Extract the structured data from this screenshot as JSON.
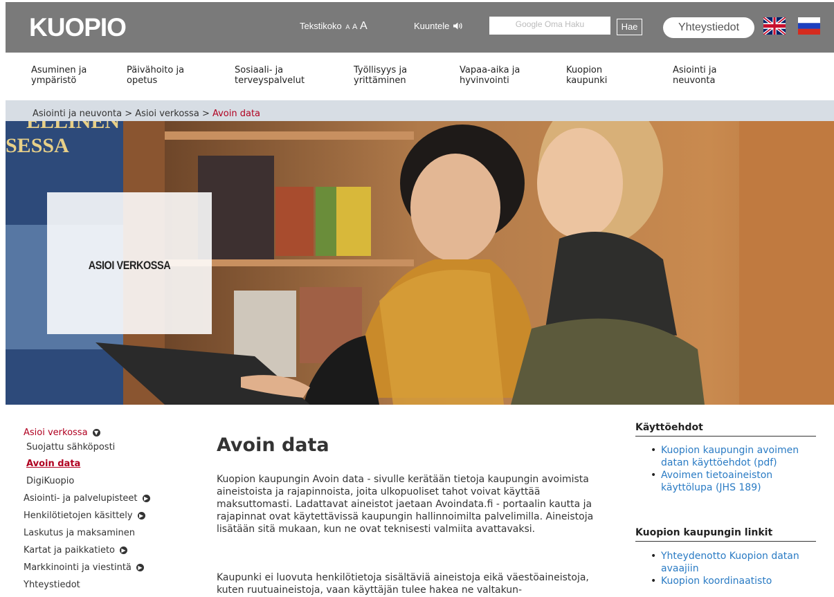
{
  "header": {
    "logo": "KUOPIO",
    "textsize_label": "Tekstikoko",
    "textsize_small": "A",
    "textsize_medium": "A",
    "textsize_large": "A",
    "listen_label": "Kuuntele",
    "search_placeholder": "Google Oma Haku",
    "search_button": "Hae",
    "contact_button": "Yhteystiedot",
    "bg_color": "#7a7a7a"
  },
  "main_nav": [
    {
      "line1": "Asuminen ja",
      "line2": "ympäristö"
    },
    {
      "line1": "Päivähoito ja",
      "line2": "opetus"
    },
    {
      "line1": "Sosiaali- ja",
      "line2": "terveyspalvelut"
    },
    {
      "line1": "Työllisyys ja",
      "line2": "yrittäminen"
    },
    {
      "line1": "Vapaa-aika ja",
      "line2": "hyvinvointi"
    },
    {
      "line1": "Kuopion",
      "line2": "kaupunki"
    },
    {
      "line1": "Asiointi ja",
      "line2": "neuvonta"
    }
  ],
  "breadcrumb": {
    "item1": "Asiointi ja neuvonta",
    "sep": ">",
    "item2": "Asioi verkossa",
    "current": "Avoin data"
  },
  "hero": {
    "title": "ASIOI VERKOSSA"
  },
  "left_nav": {
    "parent": "Asioi verkossa",
    "children": [
      "Suojattu sähköposti",
      "Avoin data",
      "DigiKuopio"
    ],
    "items": [
      "Asiointi- ja palvelupisteet",
      "Henkilötietojen käsittely",
      "Laskutus ja maksaminen",
      "Kartat ja paikkatieto",
      "Markkinointi ja viestintä",
      "Yhteystiedot"
    ]
  },
  "content": {
    "title": "Avoin data",
    "p1": "Kuopion kaupungin Avoin data - sivulle kerätään tietoja kaupungin avoimista aineistoista ja rajapinnoista, joita ulkopuoliset tahot voivat käyttää maksuttomasti. Ladattavat aineistot jaetaan Avoindata.fi - portaalin kautta ja rajapinnat ovat käytettävissä kaupungin hallinnoimilta palvelimilla. Aineistoja lisätään sitä mukaan, kun ne ovat teknisesti valmiita avattavaksi.",
    "p2": "Kaupunki ei luovuta henkilötietoja sisältäviä aineistoja eikä väestöaineistoja, kuten ruutuaineistoja, vaan käyttäjän tulee hakea ne valtakun-"
  },
  "sidebar": {
    "heading1": "Käyttöehdot",
    "links1": [
      "Kuopion kaupungin avoimen datan käyttöehdot (pdf)",
      "Avoimen tietoaineiston käyttölupa (JHS 189)"
    ],
    "heading2": "Kuopion kaupungin linkit",
    "links2": [
      "Yhteydenotto Kuopion datan avaajiin",
      "Kuopion koordinaatisto"
    ]
  },
  "colors": {
    "accent_red": "#b00020",
    "link_blue": "#2a7bc4",
    "breadcrumb_bg": "#d7dde4"
  }
}
